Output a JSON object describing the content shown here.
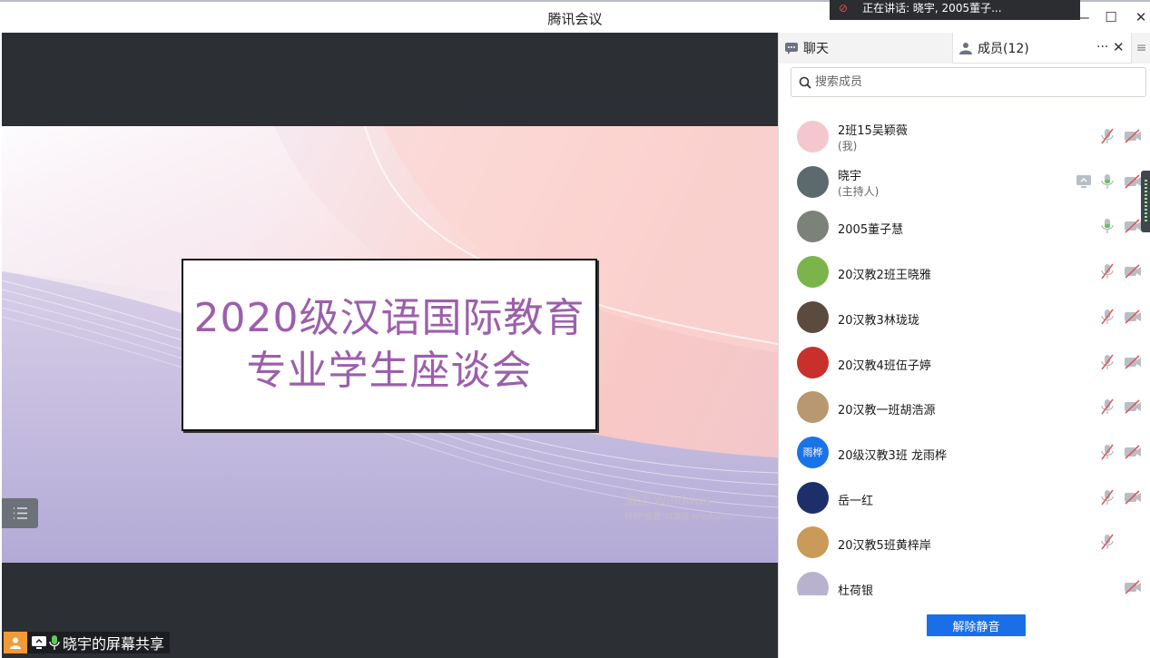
{
  "window": {
    "title": "腾讯会议",
    "speaking_banner": "正在讲话: 晓宇, 2005董子...",
    "minimize": "—",
    "maximize": "☐",
    "close": "✕"
  },
  "slide": {
    "line1": "2020级汉语国际教育",
    "line2": "专业学生座谈会",
    "watermark_title": "激活 Windows",
    "watermark_sub": "转到\"设置\"以激活 Windows。"
  },
  "share_label": "晓宇的屏幕共享",
  "panel": {
    "tab_chat": "聊天",
    "tab_members": "成员(12)",
    "more": "···",
    "close": "✕",
    "menu": "≡",
    "search_placeholder": "搜索成员",
    "unmute_all": "解除静音"
  },
  "members": [
    {
      "name": "2班15吴颖薇",
      "role": "(我)",
      "avatar_text": "",
      "avatar_color": "#f4c7cf",
      "mic": "muted",
      "video": "off",
      "screen": false
    },
    {
      "name": "晓宇",
      "role": "(主持人)",
      "avatar_text": "",
      "avatar_color": "#5c6a6e",
      "mic": "on",
      "video": "off",
      "screen": true
    },
    {
      "name": "2005董子慧",
      "role": "",
      "avatar_text": "",
      "avatar_color": "#7c8278",
      "mic": "on",
      "video": "off",
      "screen": false
    },
    {
      "name": "20汉教2班王晓雅",
      "role": "",
      "avatar_text": "",
      "avatar_color": "#7bb44a",
      "mic": "muted",
      "video": "off",
      "screen": false
    },
    {
      "name": "20汉教3林珑珑",
      "role": "",
      "avatar_text": "",
      "avatar_color": "#5b4a3e",
      "mic": "muted",
      "video": "off",
      "screen": false
    },
    {
      "name": "20汉教4班伍子婷",
      "role": "",
      "avatar_text": "",
      "avatar_color": "#c9302c",
      "mic": "muted",
      "video": "off",
      "screen": false
    },
    {
      "name": "20汉教一班胡浩源",
      "role": "",
      "avatar_text": "",
      "avatar_color": "#b79870",
      "mic": "muted",
      "video": "off",
      "screen": false
    },
    {
      "name": "20级汉教3班  龙雨桦",
      "role": "",
      "avatar_text": "雨桦",
      "avatar_color": "#1a73e8",
      "mic": "muted",
      "video": "off",
      "screen": false
    },
    {
      "name": "岳一红",
      "role": "",
      "avatar_text": "",
      "avatar_color": "#1d2f6b",
      "mic": "muted",
      "video": "off",
      "screen": false
    },
    {
      "name": "20汉教5班黄梓岸",
      "role": "",
      "avatar_text": "",
      "avatar_color": "#c99a58",
      "mic": "muted",
      "video": "none",
      "screen": false
    },
    {
      "name": "杜荷银",
      "role": "",
      "avatar_text": "",
      "avatar_color": "#b9b2cf",
      "mic": "none",
      "video": "off",
      "screen": false
    }
  ],
  "colors": {
    "accent": "#1a6fe8",
    "slide_text": "#9c5fab",
    "stage_bg": "#2c2f34",
    "share_badge": "#f29a38"
  }
}
